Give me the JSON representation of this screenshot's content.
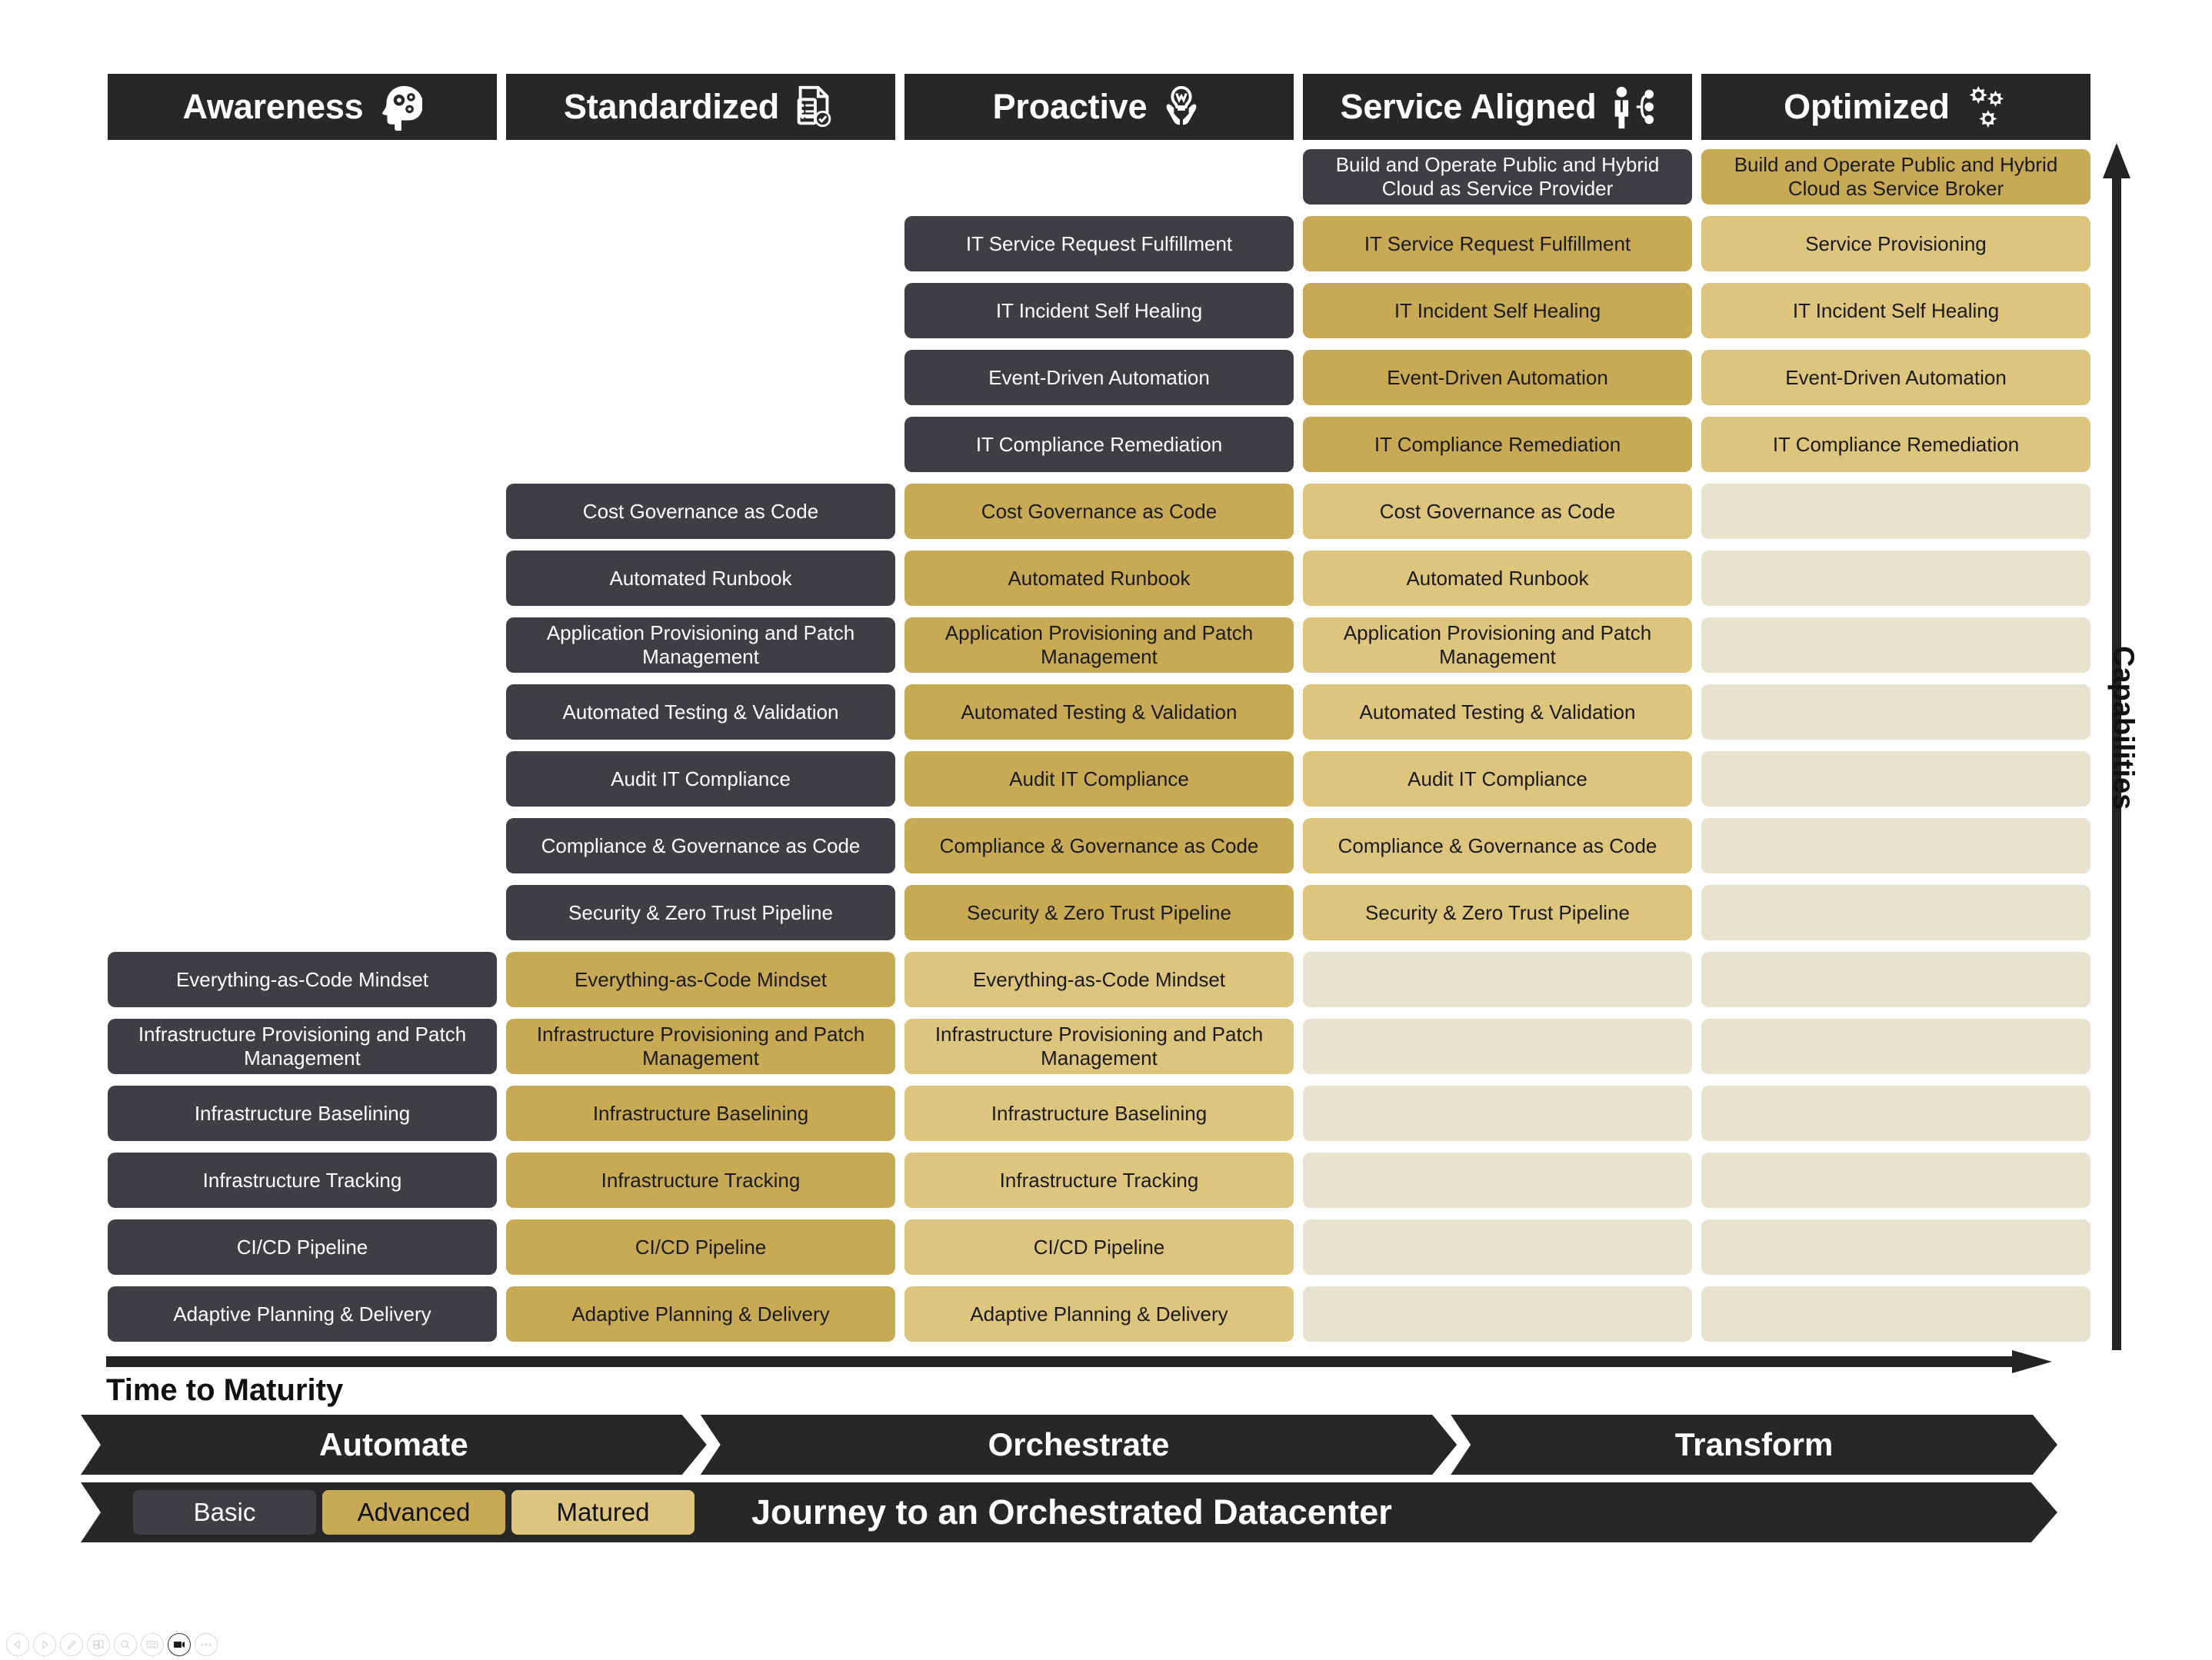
{
  "chart_data": {
    "type": "table",
    "title": "Journey to an Orchestrated Datacenter",
    "xlabel": "Time to Maturity",
    "ylabel": "Capabilities",
    "categories": [
      "Awareness",
      "Standardized",
      "Proactive",
      "Service Aligned",
      "Optimized"
    ],
    "maturity_levels": [
      "Basic",
      "Advanced",
      "Matured"
    ],
    "stages": [
      "Automate",
      "Orchestrate",
      "Transform"
    ],
    "rows": [
      {
        "capability": "Build and Operate Public and Hybrid Cloud as Service Provider",
        "cells": [
          "",
          "",
          "",
          "Build and Operate Public and Hybrid Cloud as Service Provider",
          "Build and Operate Public and Hybrid Cloud as Service Broker"
        ],
        "levels": [
          "none",
          "none",
          "none",
          "basic",
          "advanced"
        ]
      },
      {
        "capability": "IT Service Request Fulfillment",
        "cells": [
          "",
          "",
          "IT Service Request Fulfillment",
          "IT Service Request Fulfillment",
          "Service Provisioning"
        ],
        "levels": [
          "none",
          "none",
          "basic",
          "advanced",
          "matured"
        ]
      },
      {
        "capability": "IT Incident Self Healing",
        "cells": [
          "",
          "",
          "IT Incident Self Healing",
          "IT Incident Self Healing",
          "IT Incident Self Healing"
        ],
        "levels": [
          "none",
          "none",
          "basic",
          "advanced",
          "matured"
        ]
      },
      {
        "capability": "Event-Driven Automation",
        "cells": [
          "",
          "",
          "Event-Driven Automation",
          "Event-Driven Automation",
          "Event-Driven Automation"
        ],
        "levels": [
          "none",
          "none",
          "basic",
          "advanced",
          "matured"
        ]
      },
      {
        "capability": "IT Compliance Remediation",
        "cells": [
          "",
          "",
          "IT Compliance Remediation",
          "IT Compliance Remediation",
          "IT Compliance Remediation"
        ],
        "levels": [
          "none",
          "none",
          "basic",
          "advanced",
          "matured"
        ]
      },
      {
        "capability": "Cost Governance as Code",
        "cells": [
          "",
          "Cost Governance as Code",
          "Cost Governance as Code",
          "Cost Governance as Code",
          ""
        ],
        "levels": [
          "none",
          "basic",
          "advanced",
          "matured",
          "blank"
        ]
      },
      {
        "capability": "Automated Runbook",
        "cells": [
          "",
          "Automated Runbook",
          "Automated Runbook",
          "Automated Runbook",
          ""
        ],
        "levels": [
          "none",
          "basic",
          "advanced",
          "matured",
          "blank"
        ]
      },
      {
        "capability": "Application Provisioning and Patch Management",
        "cells": [
          "",
          "Application Provisioning and Patch Management",
          "Application Provisioning and Patch Management",
          "Application Provisioning and Patch Management",
          ""
        ],
        "levels": [
          "none",
          "basic",
          "advanced",
          "matured",
          "blank"
        ]
      },
      {
        "capability": "Automated Testing & Validation",
        "cells": [
          "",
          "Automated Testing & Validation",
          "Automated Testing & Validation",
          "Automated Testing & Validation",
          ""
        ],
        "levels": [
          "none",
          "basic",
          "advanced",
          "matured",
          "blank"
        ]
      },
      {
        "capability": "Audit IT Compliance",
        "cells": [
          "",
          "Audit IT Compliance",
          "Audit IT Compliance",
          "Audit IT Compliance",
          ""
        ],
        "levels": [
          "none",
          "basic",
          "advanced",
          "matured",
          "blank"
        ]
      },
      {
        "capability": "Compliance & Governance as Code",
        "cells": [
          "",
          "Compliance & Governance as Code",
          "Compliance & Governance as Code",
          "Compliance & Governance as Code",
          ""
        ],
        "levels": [
          "none",
          "basic",
          "advanced",
          "matured",
          "blank"
        ]
      },
      {
        "capability": "Security & Zero Trust Pipeline",
        "cells": [
          "",
          "Security & Zero Trust Pipeline",
          "Security & Zero Trust Pipeline",
          "Security & Zero Trust Pipeline",
          ""
        ],
        "levels": [
          "none",
          "basic",
          "advanced",
          "matured",
          "blank"
        ]
      },
      {
        "capability": "Everything-as-Code Mindset",
        "cells": [
          "Everything-as-Code Mindset",
          "Everything-as-Code Mindset",
          "Everything-as-Code Mindset",
          "",
          ""
        ],
        "levels": [
          "basic",
          "advanced",
          "matured",
          "blank",
          "blank"
        ]
      },
      {
        "capability": "Infrastructure Provisioning and Patch Management",
        "cells": [
          "Infrastructure Provisioning and Patch Management",
          "Infrastructure Provisioning and Patch Management",
          "Infrastructure Provisioning and Patch Management",
          "",
          ""
        ],
        "levels": [
          "basic",
          "advanced",
          "matured",
          "blank",
          "blank"
        ]
      },
      {
        "capability": "Infrastructure Baselining",
        "cells": [
          "Infrastructure Baselining",
          "Infrastructure Baselining",
          "Infrastructure Baselining",
          "",
          ""
        ],
        "levels": [
          "basic",
          "advanced",
          "matured",
          "blank",
          "blank"
        ]
      },
      {
        "capability": "Infrastructure Tracking",
        "cells": [
          "Infrastructure Tracking",
          "Infrastructure Tracking",
          "Infrastructure Tracking",
          "",
          ""
        ],
        "levels": [
          "basic",
          "advanced",
          "matured",
          "blank",
          "blank"
        ]
      },
      {
        "capability": "CI/CD Pipeline",
        "cells": [
          "CI/CD Pipeline",
          "CI/CD Pipeline",
          "CI/CD Pipeline",
          "",
          ""
        ],
        "levels": [
          "basic",
          "advanced",
          "matured",
          "blank",
          "blank"
        ]
      },
      {
        "capability": "Adaptive Planning & Delivery",
        "cells": [
          "Adaptive Planning & Delivery",
          "Adaptive Planning & Delivery",
          "Adaptive Planning & Delivery",
          "",
          ""
        ],
        "levels": [
          "basic",
          "advanced",
          "matured",
          "blank",
          "blank"
        ]
      }
    ],
    "colors": {
      "basic": "#3e3e46",
      "advanced": "#c8a954",
      "matured": "#ddc57e",
      "blank": "#e9e2cf",
      "header": "#272727"
    }
  },
  "headers": [
    {
      "label": "Awareness",
      "icon": "head-gears-icon"
    },
    {
      "label": "Standardized",
      "icon": "document-check-icon"
    },
    {
      "label": "Proactive",
      "icon": "hands-bulb-icon"
    },
    {
      "label": "Service Aligned",
      "icon": "person-network-icon"
    },
    {
      "label": "Optimized",
      "icon": "gears-icon"
    }
  ],
  "axes": {
    "vertical_label": "Capabilities",
    "horizontal_label": "Time to Maturity"
  },
  "stages": [
    {
      "label": "Automate"
    },
    {
      "label": "Orchestrate"
    },
    {
      "label": "Transform"
    }
  ],
  "legend": {
    "chips": [
      {
        "label": "Basic",
        "level": "basic"
      },
      {
        "label": "Advanced",
        "level": "advanced"
      },
      {
        "label": "Matured",
        "level": "matured"
      }
    ],
    "title": "Journey to an Orchestrated Datacenter"
  },
  "toolbar": {
    "buttons": [
      {
        "name": "back-icon"
      },
      {
        "name": "forward-icon"
      },
      {
        "name": "pen-icon"
      },
      {
        "name": "layout-icon"
      },
      {
        "name": "search-icon"
      },
      {
        "name": "keyboard-icon"
      },
      {
        "name": "camera-icon"
      },
      {
        "name": "more-icon"
      }
    ]
  }
}
